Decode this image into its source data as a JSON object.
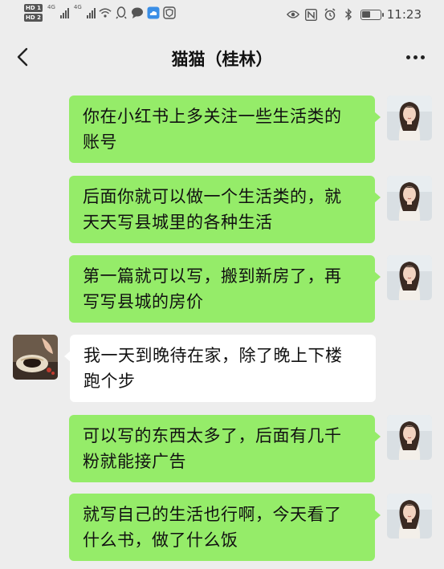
{
  "status_bar": {
    "sim1_badge": "HD 1",
    "sim2_badge": "HD 2",
    "network1": "4G",
    "network2": "4G",
    "time": "11:23",
    "battery_level": 0.55,
    "icons_left": [
      "wifi-icon",
      "qq-penguin-icon",
      "chat-bubble-icon",
      "cloud-icon",
      "shield-icon"
    ],
    "icons_right": [
      "eye-icon",
      "nfc-icon",
      "alarm-icon",
      "bluetooth-icon",
      "battery-icon"
    ]
  },
  "header": {
    "title": "猫猫（桂林）",
    "back_icon": "chevron-left-icon",
    "more_icon": "more-dots-icon"
  },
  "colors": {
    "background": "#ededed",
    "sent_bubble": "#95ec69",
    "received_bubble": "#ffffff"
  },
  "messages": [
    {
      "direction": "sent",
      "lines": [
        "你在小红书上多关注一些生活类的",
        "账号"
      ]
    },
    {
      "direction": "sent",
      "lines": [
        "后面你就可以做一个生活类的，就",
        "天天写县城里的各种生活"
      ]
    },
    {
      "direction": "sent",
      "lines": [
        "第一篇就可以写，搬到新房了，再",
        "写写县城的房价"
      ]
    },
    {
      "direction": "received",
      "lines": [
        "我一天到晚待在家，除了晚上下楼",
        "跑个步"
      ]
    },
    {
      "direction": "sent",
      "lines": [
        "可以写的东西太多了，后面有几千",
        "粉就能接广告"
      ]
    },
    {
      "direction": "sent",
      "lines": [
        "就写自己的生活也行啊，今天看了",
        "什么书，做了什么饭"
      ]
    }
  ]
}
